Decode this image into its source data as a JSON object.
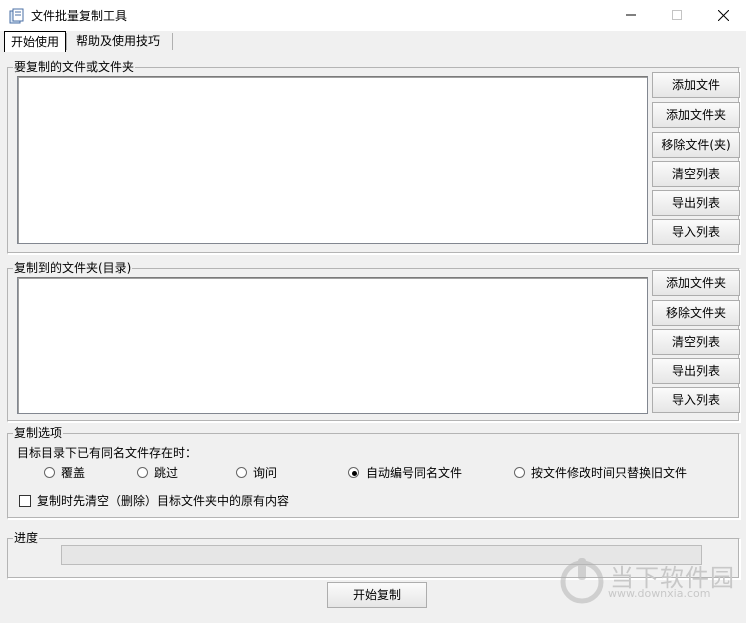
{
  "window": {
    "title": "文件批量复制工具",
    "minimize_icon": "minimize-icon",
    "maximize_icon": "maximize-icon",
    "close_icon": "close-icon"
  },
  "tabs": [
    {
      "label": "开始使用",
      "active": true
    },
    {
      "label": "帮助及使用技巧",
      "active": false
    }
  ],
  "source_group": {
    "label": "要复制的文件或文件夹",
    "buttons": [
      "添加文件",
      "添加文件夹",
      "移除文件(夹)",
      "清空列表",
      "导出列表",
      "导入列表"
    ]
  },
  "target_group": {
    "label": "复制到的文件夹(目录)",
    "buttons": [
      "添加文件夹",
      "移除文件夹",
      "清空列表",
      "导出列表",
      "导入列表"
    ]
  },
  "options_group": {
    "label": "复制选项",
    "prompt": "目标目录下已有同名文件存在时：",
    "radios": [
      {
        "label": "覆盖",
        "selected": false
      },
      {
        "label": "跳过",
        "selected": false
      },
      {
        "label": "询问",
        "selected": false
      },
      {
        "label": "自动编号同名文件",
        "selected": true
      },
      {
        "label": "按文件修改时间只替换旧文件",
        "selected": false
      }
    ],
    "clear_checkbox": {
      "label": "复制时先清空（删除）目标文件夹中的原有内容",
      "checked": false
    }
  },
  "progress_group": {
    "label": "进度",
    "value": 0
  },
  "start_button": {
    "label": "开始复制"
  },
  "watermark": {
    "brand": "当下软件园",
    "url": "www.downxia.com"
  },
  "colors": {
    "window_bg": "#f0f0f0",
    "list_bg": "#ffffff",
    "selected_radio": "#000000"
  }
}
